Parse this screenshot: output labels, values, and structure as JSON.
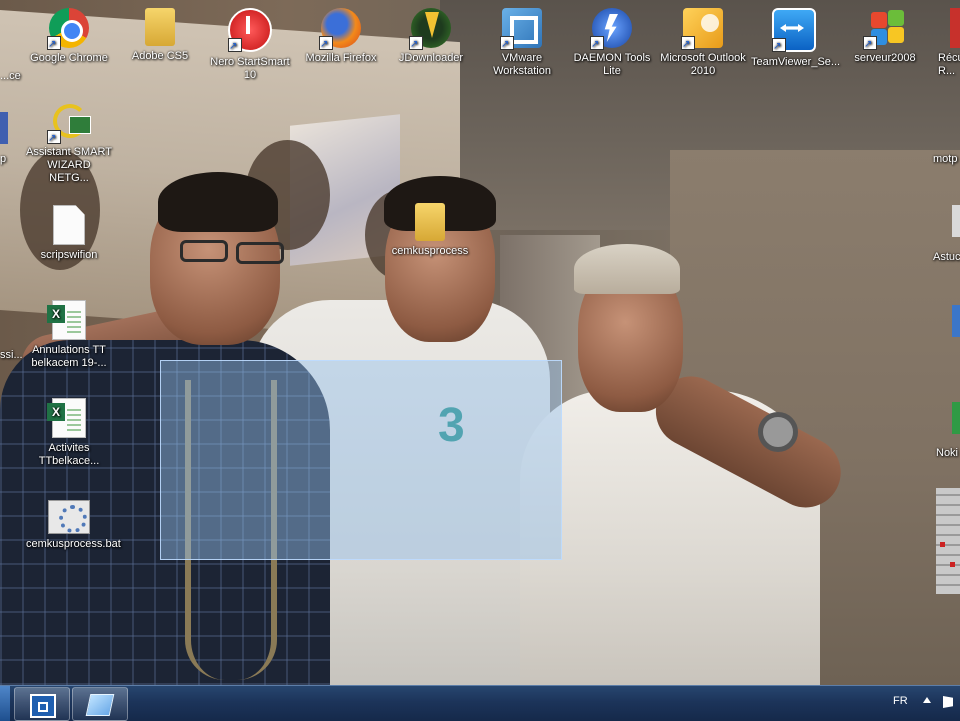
{
  "desktop": {
    "icons": [
      {
        "name": "Google Chrome"
      },
      {
        "name": "Adobe CS5"
      },
      {
        "name": "Nero StartSmart 10"
      },
      {
        "name": "Mozilla Firefox"
      },
      {
        "name": "JDownloader"
      },
      {
        "name": "VMware Workstation"
      },
      {
        "name": "DAEMON Tools Lite"
      },
      {
        "name": "Microsoft Outlook 2010"
      },
      {
        "name": "TeamViewer_Se..."
      },
      {
        "name": "serveur2008"
      },
      {
        "name": "Récu R..."
      },
      {
        "name": "Assistant SMART WIZARD NETG..."
      },
      {
        "name": "scripswifion"
      },
      {
        "name": "cemkusprocess"
      },
      {
        "name": "Annulations TT belkacem 19-..."
      },
      {
        "name": "Activites TTbelkace..."
      },
      {
        "name": "cemkusprocess.bat"
      }
    ],
    "edge_labels": {
      "left_top": "...ce",
      "left_p": "p",
      "left_ssi": "ssi...",
      "right_motp": "motp",
      "right_astuc": "Astuc",
      "right_noki": "Noki"
    }
  },
  "taskbar": {
    "language": "FR",
    "buttons": [
      {
        "name": "remote-desktop-connection"
      },
      {
        "name": "show-desktop-screen"
      }
    ]
  },
  "colors": {
    "taskbar": "#1c345a",
    "selection": "#96c3f0",
    "jersey_number": "#1b8a7f"
  },
  "wallpaper": {
    "jersey_number": "3"
  }
}
